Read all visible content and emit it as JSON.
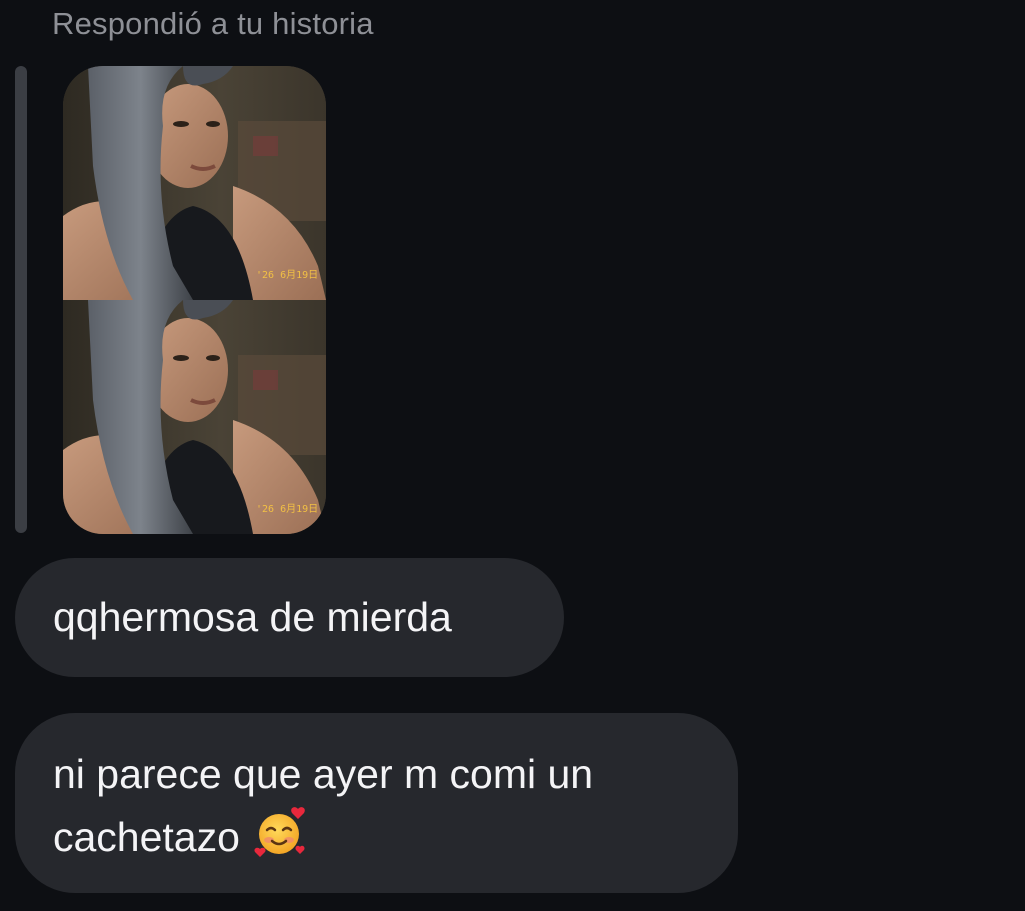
{
  "reply_header": "Respondió a tu historia",
  "story": {
    "stamp": "'26 6月19日",
    "frames": 2
  },
  "messages": [
    {
      "text": "qqhermosa de mierda"
    },
    {
      "line1": "ni parece que ayer m comi un",
      "line2": "cachetazo",
      "emoji": "smiling-face-with-hearts-icon"
    }
  ],
  "colors": {
    "background": "#0d0f13",
    "bubble": "#26282d",
    "text": "#f4f4f6",
    "muted": "#8e9096",
    "stamp": "#f2c044"
  }
}
